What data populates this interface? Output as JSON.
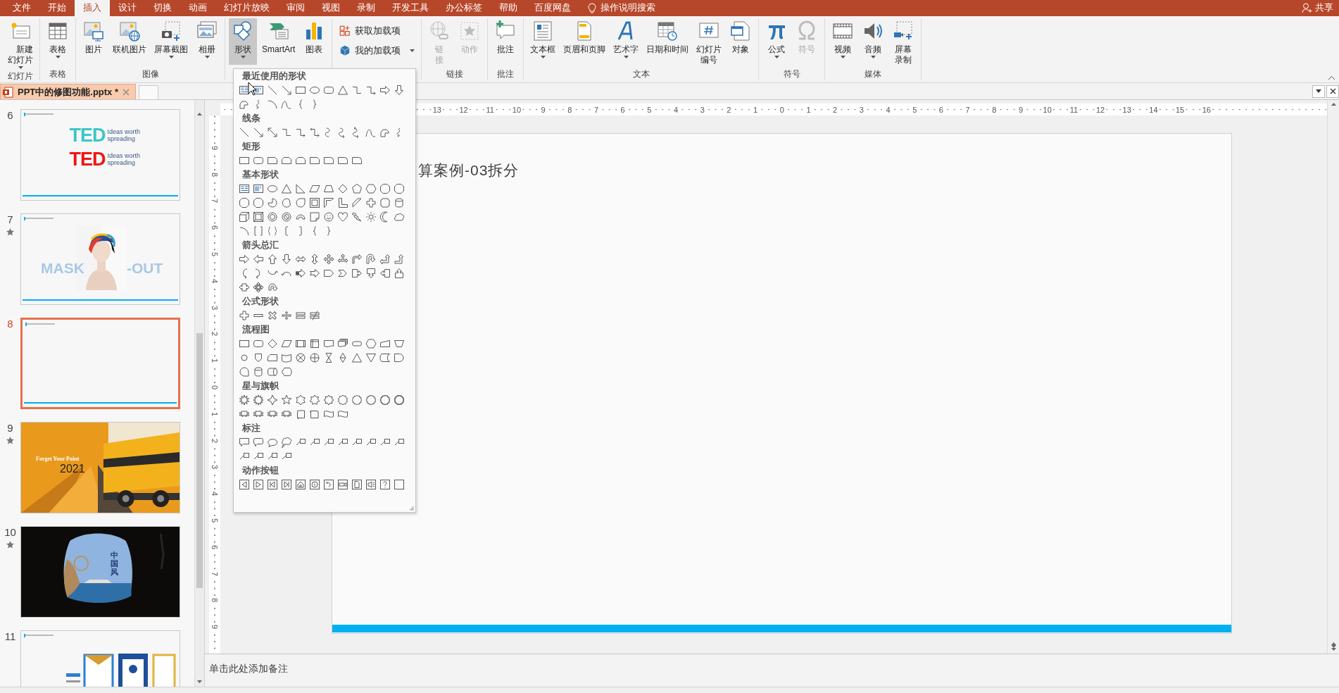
{
  "menu_tabs": [
    {
      "label": "文件",
      "selected": false
    },
    {
      "label": "开始",
      "selected": false
    },
    {
      "label": "插入",
      "selected": true
    },
    {
      "label": "设计",
      "selected": false
    },
    {
      "label": "切换",
      "selected": false
    },
    {
      "label": "动画",
      "selected": false
    },
    {
      "label": "幻灯片放映",
      "selected": false
    },
    {
      "label": "审阅",
      "selected": false
    },
    {
      "label": "视图",
      "selected": false
    },
    {
      "label": "录制",
      "selected": false
    },
    {
      "label": "开发工具",
      "selected": false
    },
    {
      "label": "办公标签",
      "selected": false
    },
    {
      "label": "帮助",
      "selected": false
    },
    {
      "label": "百度网盘",
      "selected": false
    }
  ],
  "tell_me": "操作说明搜索",
  "share": "共享",
  "ribbon": {
    "groups": [
      {
        "label": "幻灯片",
        "buttons": [
          {
            "label": "新建幻灯片",
            "kind": "large",
            "dropdown": true,
            "pressed": false,
            "disabled": false
          }
        ]
      },
      {
        "label": "表格",
        "buttons": [
          {
            "label": "表格",
            "kind": "large",
            "dropdown": true,
            "pressed": false,
            "disabled": false
          }
        ]
      },
      {
        "label": "图像",
        "buttons": [
          {
            "label": "图片",
            "kind": "large",
            "dropdown": false,
            "pressed": false,
            "disabled": false
          },
          {
            "label": "联机图片",
            "kind": "large",
            "dropdown": false,
            "pressed": false,
            "disabled": false
          },
          {
            "label": "屏幕截图",
            "kind": "large",
            "dropdown": true,
            "pressed": false,
            "disabled": false
          },
          {
            "label": "相册",
            "kind": "large",
            "dropdown": true,
            "pressed": false,
            "disabled": false
          }
        ]
      },
      {
        "buttons": [
          {
            "label": "形状",
            "kind": "large",
            "dropdown": true,
            "pressed": true,
            "disabled": false
          },
          {
            "label": "SmartArt",
            "kind": "large",
            "dropdown": false,
            "pressed": false,
            "disabled": false
          },
          {
            "label": "图表",
            "kind": "large",
            "dropdown": false,
            "pressed": false,
            "disabled": false
          }
        ]
      },
      {
        "buttons": [
          {
            "label": "获取加载项",
            "kind": "small",
            "dropdown": false,
            "pressed": false,
            "disabled": false
          },
          {
            "label": "我的加载项",
            "kind": "small",
            "dropdown": true,
            "pressed": false,
            "disabled": false
          }
        ]
      },
      {
        "label": "链接",
        "buttons": [
          {
            "label": "链接",
            "kind": "large",
            "dropdown": false,
            "pressed": false,
            "disabled": true
          },
          {
            "label": "动作",
            "kind": "large",
            "dropdown": false,
            "pressed": false,
            "disabled": true
          }
        ]
      },
      {
        "label": "批注",
        "buttons": [
          {
            "label": "批注",
            "kind": "large",
            "dropdown": false,
            "pressed": false,
            "disabled": false
          }
        ]
      },
      {
        "label": "文本",
        "buttons": [
          {
            "label": "文本框",
            "kind": "large",
            "dropdown": true,
            "pressed": false,
            "disabled": false
          },
          {
            "label": "页眉和页脚",
            "kind": "large",
            "dropdown": false,
            "pressed": false,
            "disabled": false
          },
          {
            "label": "艺术字",
            "kind": "large",
            "dropdown": true,
            "pressed": false,
            "disabled": false
          },
          {
            "label": "日期和时间",
            "kind": "large",
            "dropdown": false,
            "pressed": false,
            "disabled": false
          },
          {
            "label": "幻灯片编号",
            "kind": "large",
            "dropdown": false,
            "pressed": false,
            "disabled": false
          },
          {
            "label": "对象",
            "kind": "large",
            "dropdown": false,
            "pressed": false,
            "disabled": false
          }
        ]
      },
      {
        "label": "符号",
        "buttons": [
          {
            "label": "公式",
            "kind": "large",
            "dropdown": true,
            "pressed": false,
            "disabled": false
          },
          {
            "label": "符号",
            "kind": "large",
            "dropdown": false,
            "pressed": false,
            "disabled": true
          }
        ]
      },
      {
        "label": "媒体",
        "buttons": [
          {
            "label": "视频",
            "kind": "large",
            "dropdown": true,
            "pressed": false,
            "disabled": false
          },
          {
            "label": "音频",
            "kind": "large",
            "dropdown": true,
            "pressed": false,
            "disabled": false
          },
          {
            "label": "屏幕录制",
            "kind": "large",
            "dropdown": false,
            "pressed": false,
            "disabled": false
          }
        ]
      }
    ]
  },
  "document_tab": {
    "label": "PPT中的修图功能.pptx *"
  },
  "slides": [
    {
      "number": "6",
      "animated": false,
      "selected": false,
      "kind": "ted",
      "rows": [
        {
          "logo": "TED",
          "tagline": "Ideas worth spreading",
          "color": "#3cc6c4"
        },
        {
          "logo": "TED",
          "tagline": "Ideas worth spreading",
          "color": "#f01414"
        }
      ]
    },
    {
      "number": "7",
      "animated": true,
      "selected": false,
      "kind": "portrait",
      "texts": [
        "MASK",
        "-OUT"
      ]
    },
    {
      "number": "8",
      "animated": false,
      "selected": true,
      "kind": "blank"
    },
    {
      "number": "9",
      "animated": true,
      "selected": false,
      "kind": "truck",
      "texts": [
        "Forget Your Point",
        "2021"
      ]
    },
    {
      "number": "10",
      "animated": true,
      "selected": false,
      "kind": "cave",
      "texts": [
        "中国风"
      ]
    },
    {
      "number": "11",
      "animated": false,
      "selected": false,
      "kind": "certificate"
    }
  ],
  "horizontal_ruler": [
    "13",
    "12",
    "11",
    "10",
    "9",
    "8",
    "7",
    "6",
    "5",
    "4",
    "3",
    "2",
    "1",
    "0",
    "1",
    "2",
    "3",
    "4",
    "5",
    "6",
    "7",
    "8",
    "9",
    "10",
    "11",
    "12",
    "13",
    "14",
    "15",
    "16"
  ],
  "vertical_ruler": [
    "9",
    "8",
    "7",
    "6",
    "5",
    "4",
    "3",
    "2",
    "1",
    "0",
    "1",
    "2",
    "3",
    "4",
    "5",
    "6",
    "7",
    "8",
    "9"
  ],
  "slide": {
    "title": "算案例-03拆分"
  },
  "notes_placeholder": "单击此处添加备注",
  "shapes_gallery": {
    "sections": [
      {
        "title": "最近使用的形状"
      },
      {
        "title": "线条"
      },
      {
        "title": "矩形"
      },
      {
        "title": "基本形状"
      },
      {
        "title": "箭头总汇"
      },
      {
        "title": "公式形状"
      },
      {
        "title": "流程图"
      },
      {
        "title": "星与旗帜"
      },
      {
        "title": "标注"
      },
      {
        "title": "动作按钮"
      }
    ]
  }
}
